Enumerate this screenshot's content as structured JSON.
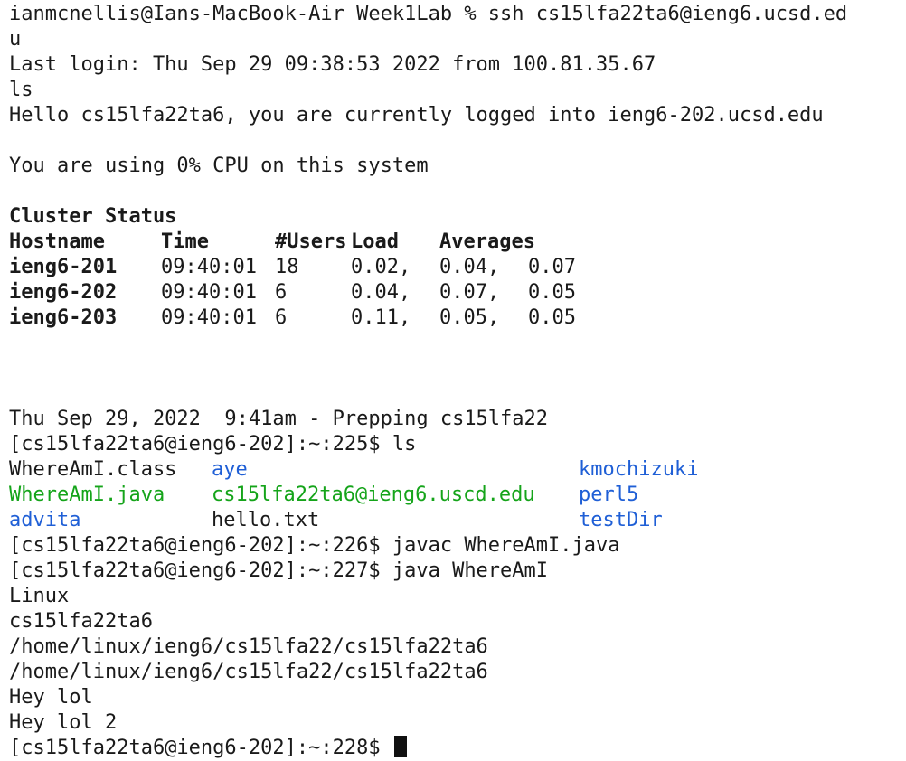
{
  "session": {
    "ssh_command_line": "ianmcnellis@Ians-MacBook-Air Week1Lab % ssh cs15lfa22ta6@ieng6.ucsd.ed",
    "ssh_command_wrap": "u",
    "last_login": "Last login: Thu Sep 29 09:38:53 2022 from 100.81.35.67",
    "typed_ls": "ls",
    "hello": "Hello cs15lfa22ta6, you are currently logged into ieng6-202.ucsd.edu",
    "cpu": "You are using 0% CPU on this system"
  },
  "cluster": {
    "title": "Cluster Status",
    "headers": [
      "Hostname",
      "Time",
      "#Users",
      "Load",
      "Averages",
      ""
    ],
    "rows": [
      [
        "ieng6-201",
        "09:40:01",
        "18",
        "0.02,",
        "0.04,",
        "0.07"
      ],
      [
        "ieng6-202",
        "09:40:01",
        "6",
        "0.04,",
        "0.07,",
        "0.05"
      ],
      [
        "ieng6-203",
        "09:40:01",
        "6",
        "0.11,",
        "0.05,",
        "0.05"
      ]
    ]
  },
  "prep_banner": "Thu Sep 29, 2022  9:41am - Prepping cs15lfa22",
  "prompt_ls": "[cs15lfa22ta6@ieng6-202]:~:225$ ls",
  "ls_listing": [
    [
      {
        "name": "WhereAmI.class",
        "kind": "file"
      },
      {
        "name": "aye",
        "kind": "dir"
      },
      {
        "name": "kmochizuki",
        "kind": "dir"
      }
    ],
    [
      {
        "name": "WhereAmI.java",
        "kind": "exec"
      },
      {
        "name": "cs15lfa22ta6@ieng6.uscd.edu",
        "kind": "exec"
      },
      {
        "name": "perl5",
        "kind": "dir"
      }
    ],
    [
      {
        "name": "advita",
        "kind": "dir"
      },
      {
        "name": "hello.txt",
        "kind": "file"
      },
      {
        "name": "testDir",
        "kind": "dir"
      }
    ]
  ],
  "prompt_javac": "[cs15lfa22ta6@ieng6-202]:~:226$ javac WhereAmI.java",
  "prompt_java": "[cs15lfa22ta6@ieng6-202]:~:227$ java WhereAmI",
  "program_output": [
    "Linux",
    "cs15lfa22ta6",
    "/home/linux/ieng6/cs15lfa22/cs15lfa22ta6",
    "/home/linux/ieng6/cs15lfa22/cs15lfa22ta6",
    "Hey lol",
    "Hey lol 2"
  ],
  "final_prompt": "[cs15lfa22ta6@ieng6-202]:~:228$ ",
  "colors": {
    "directory": "#1f5fd6",
    "executable": "#15a41a",
    "text": "#1a1a1a",
    "background": "#ffffff"
  }
}
